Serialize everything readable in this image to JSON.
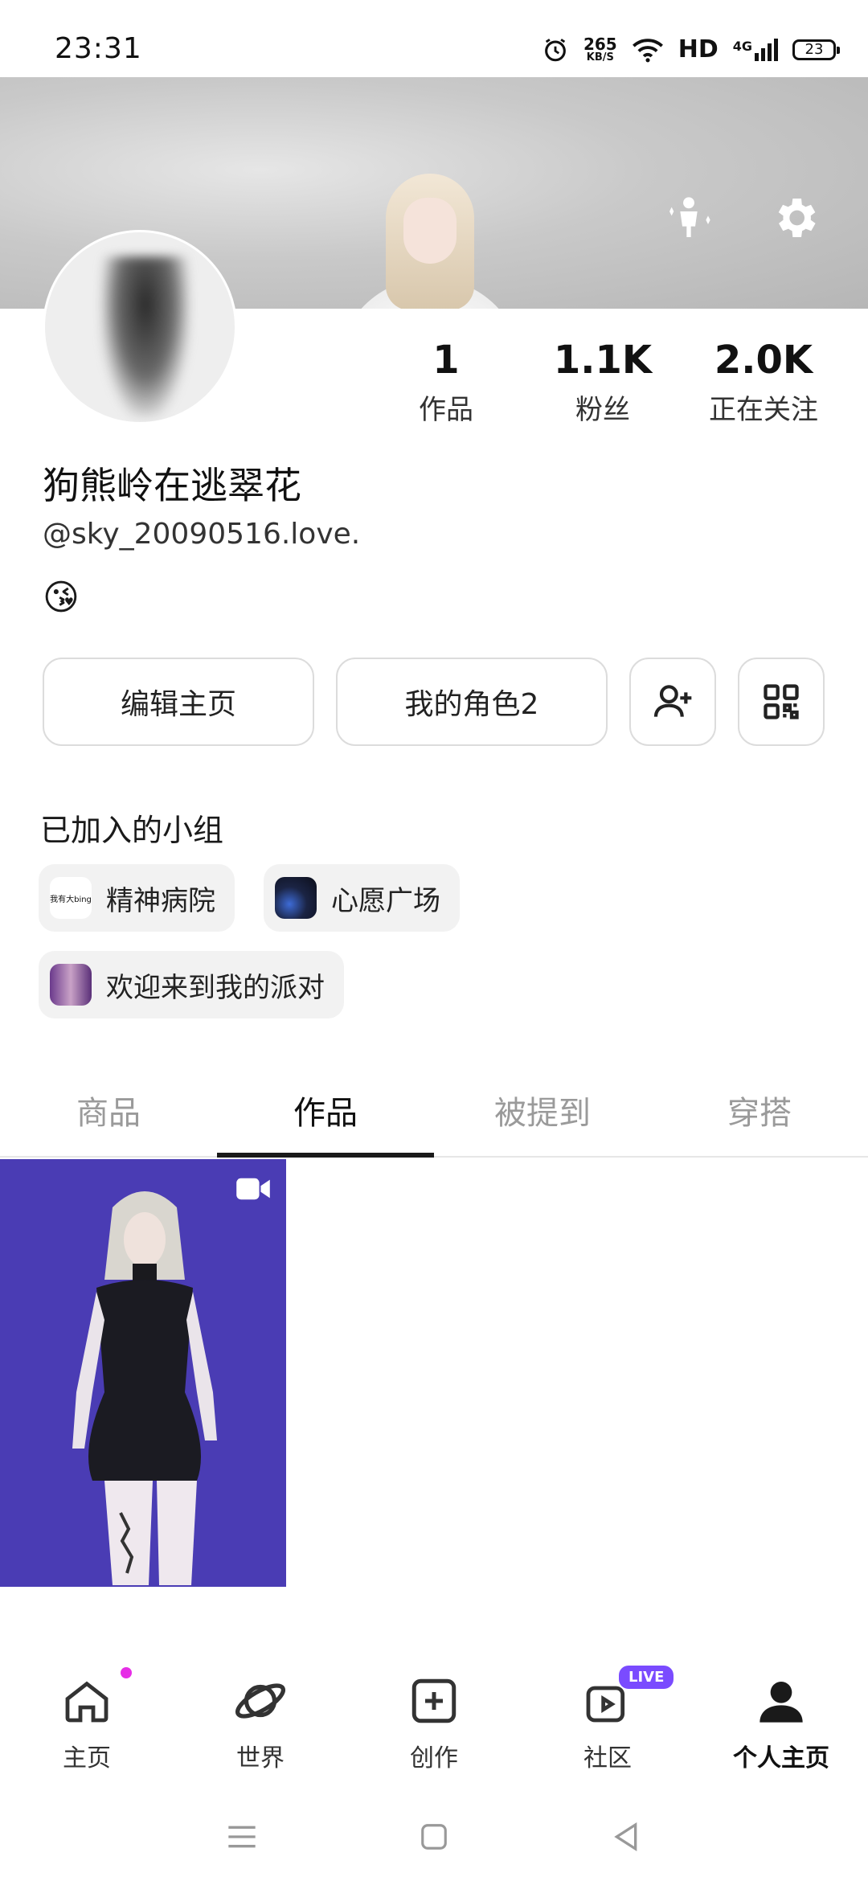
{
  "status_bar": {
    "time": "23:31",
    "net_speed": "265",
    "net_unit": "KB/S",
    "hd": "HD",
    "signal_label": "4G",
    "battery": "23"
  },
  "profile": {
    "stats": [
      {
        "value": "1",
        "label": "作品"
      },
      {
        "value": "1.1K",
        "label": "粉丝"
      },
      {
        "value": "2.0K",
        "label": "正在关注"
      }
    ],
    "username": "狗熊岭在逃翠花",
    "handle": "@sky_20090516.love.",
    "bio_emoji": "😘"
  },
  "actions": {
    "edit_profile": "编辑主页",
    "my_role": "我的角色2"
  },
  "groups": {
    "title": "已加入的小组",
    "items": [
      {
        "name": "精神病院",
        "icon_text": "我有大bing"
      },
      {
        "name": "心愿广场"
      },
      {
        "name": "欢迎来到我的派对"
      }
    ]
  },
  "tabs": [
    "商品",
    "作品",
    "被提到",
    "穿搭"
  ],
  "active_tab": "作品",
  "bottom_nav": [
    {
      "label": "主页",
      "icon": "home-icon"
    },
    {
      "label": "世界",
      "icon": "planet-icon"
    },
    {
      "label": "创作",
      "icon": "create-icon"
    },
    {
      "label": "社区",
      "icon": "community-icon",
      "badge": "LIVE"
    },
    {
      "label": "个人主页",
      "icon": "profile-icon"
    }
  ],
  "colors": {
    "accent_dot": "#e62ee6",
    "live_badge": "#7a4bff",
    "post_bg": "#4a3cb4"
  }
}
